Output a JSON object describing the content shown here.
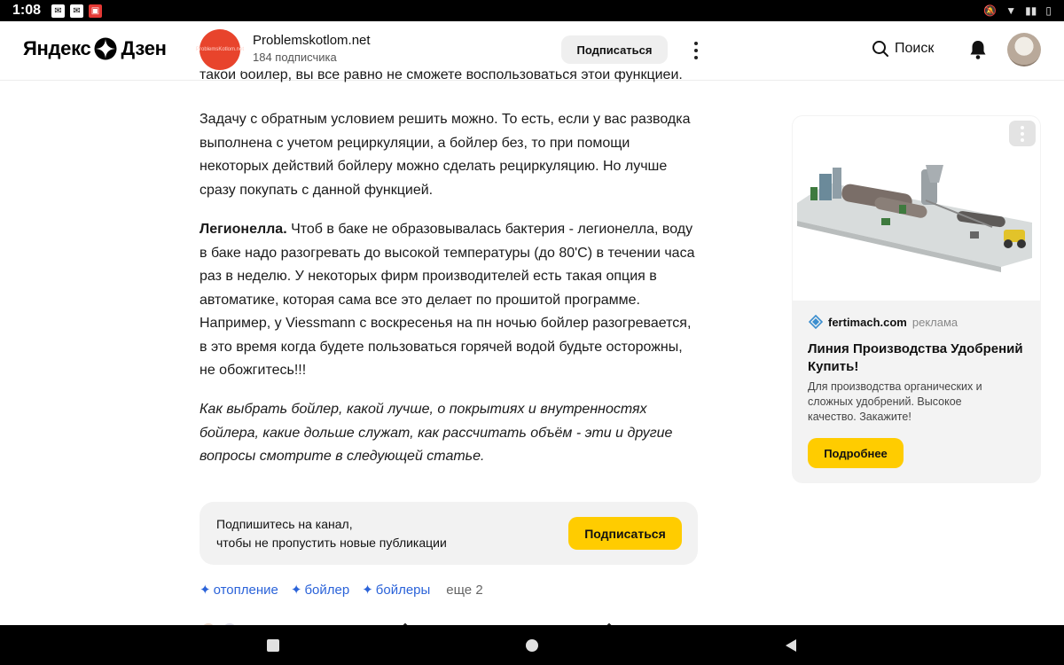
{
  "status_bar": {
    "time": "1:08"
  },
  "header": {
    "logo_left": "Яндекс",
    "logo_right": "Дзен",
    "channel": {
      "name": "Problemskotlom.net",
      "subscribers": "184 подписчика",
      "avatar_text": "ProblemsKotlom.net"
    },
    "subscribe_label": "Подписаться",
    "search_label": "Поиск"
  },
  "article": {
    "clipped_line": "такой бойлер, вы все равно не сможете воспользоваться этой функцией.",
    "paragraph_1": "Задачу с обратным условием решить можно. То есть, если у вас разводка выполнена с учетом рециркуляции, а бойлер без, то при помощи некоторых действий бойлеру можно сделать рециркуляцию. Но лучше сразу покупать с данной функцией.",
    "paragraph_2_bold": "Легионелла.",
    "paragraph_2_text": " Чтоб в баке не образовывалась бактерия - легионелла, воду в баке надо разогревать до высокой температуры (до 80'С) в течении часа раз в неделю. У некоторых фирм производителей есть такая опция в автоматике, которая сама все это делает по прошитой программе. Например, у Viessmann с воскресенья на пн ночью бойлер разогревается, в это время когда будете пользоваться горячей водой будьте осторожны, не обожгитесь!!!",
    "paragraph_3": "Как выбрать бойлер, какой лучше, о покрытиях и внутренностях бойлера, какие дольше служат, как рассчитать объём - эти и другие вопросы смотрите в следующей статье."
  },
  "subscribe_block": {
    "line_1": "Подпишитесь на канал,",
    "line_2": "чтобы не пропустить новые публикации",
    "button": "Подписаться"
  },
  "tags": {
    "items": [
      "отопление",
      "бойлер",
      "бойлеры"
    ],
    "more": "еще 2"
  },
  "ad": {
    "domain": "fertimach.com",
    "label": "реклама",
    "title": "Линия Производства Удобрений Купить!",
    "description": "Для производства органических и сложных удобрений. Высокое качество. Закажите!",
    "button": "Подробнее"
  },
  "colors": {
    "accent_yellow": "#ffcc00",
    "tag_blue": "#2b63d9",
    "channel_red": "#e8442c"
  }
}
